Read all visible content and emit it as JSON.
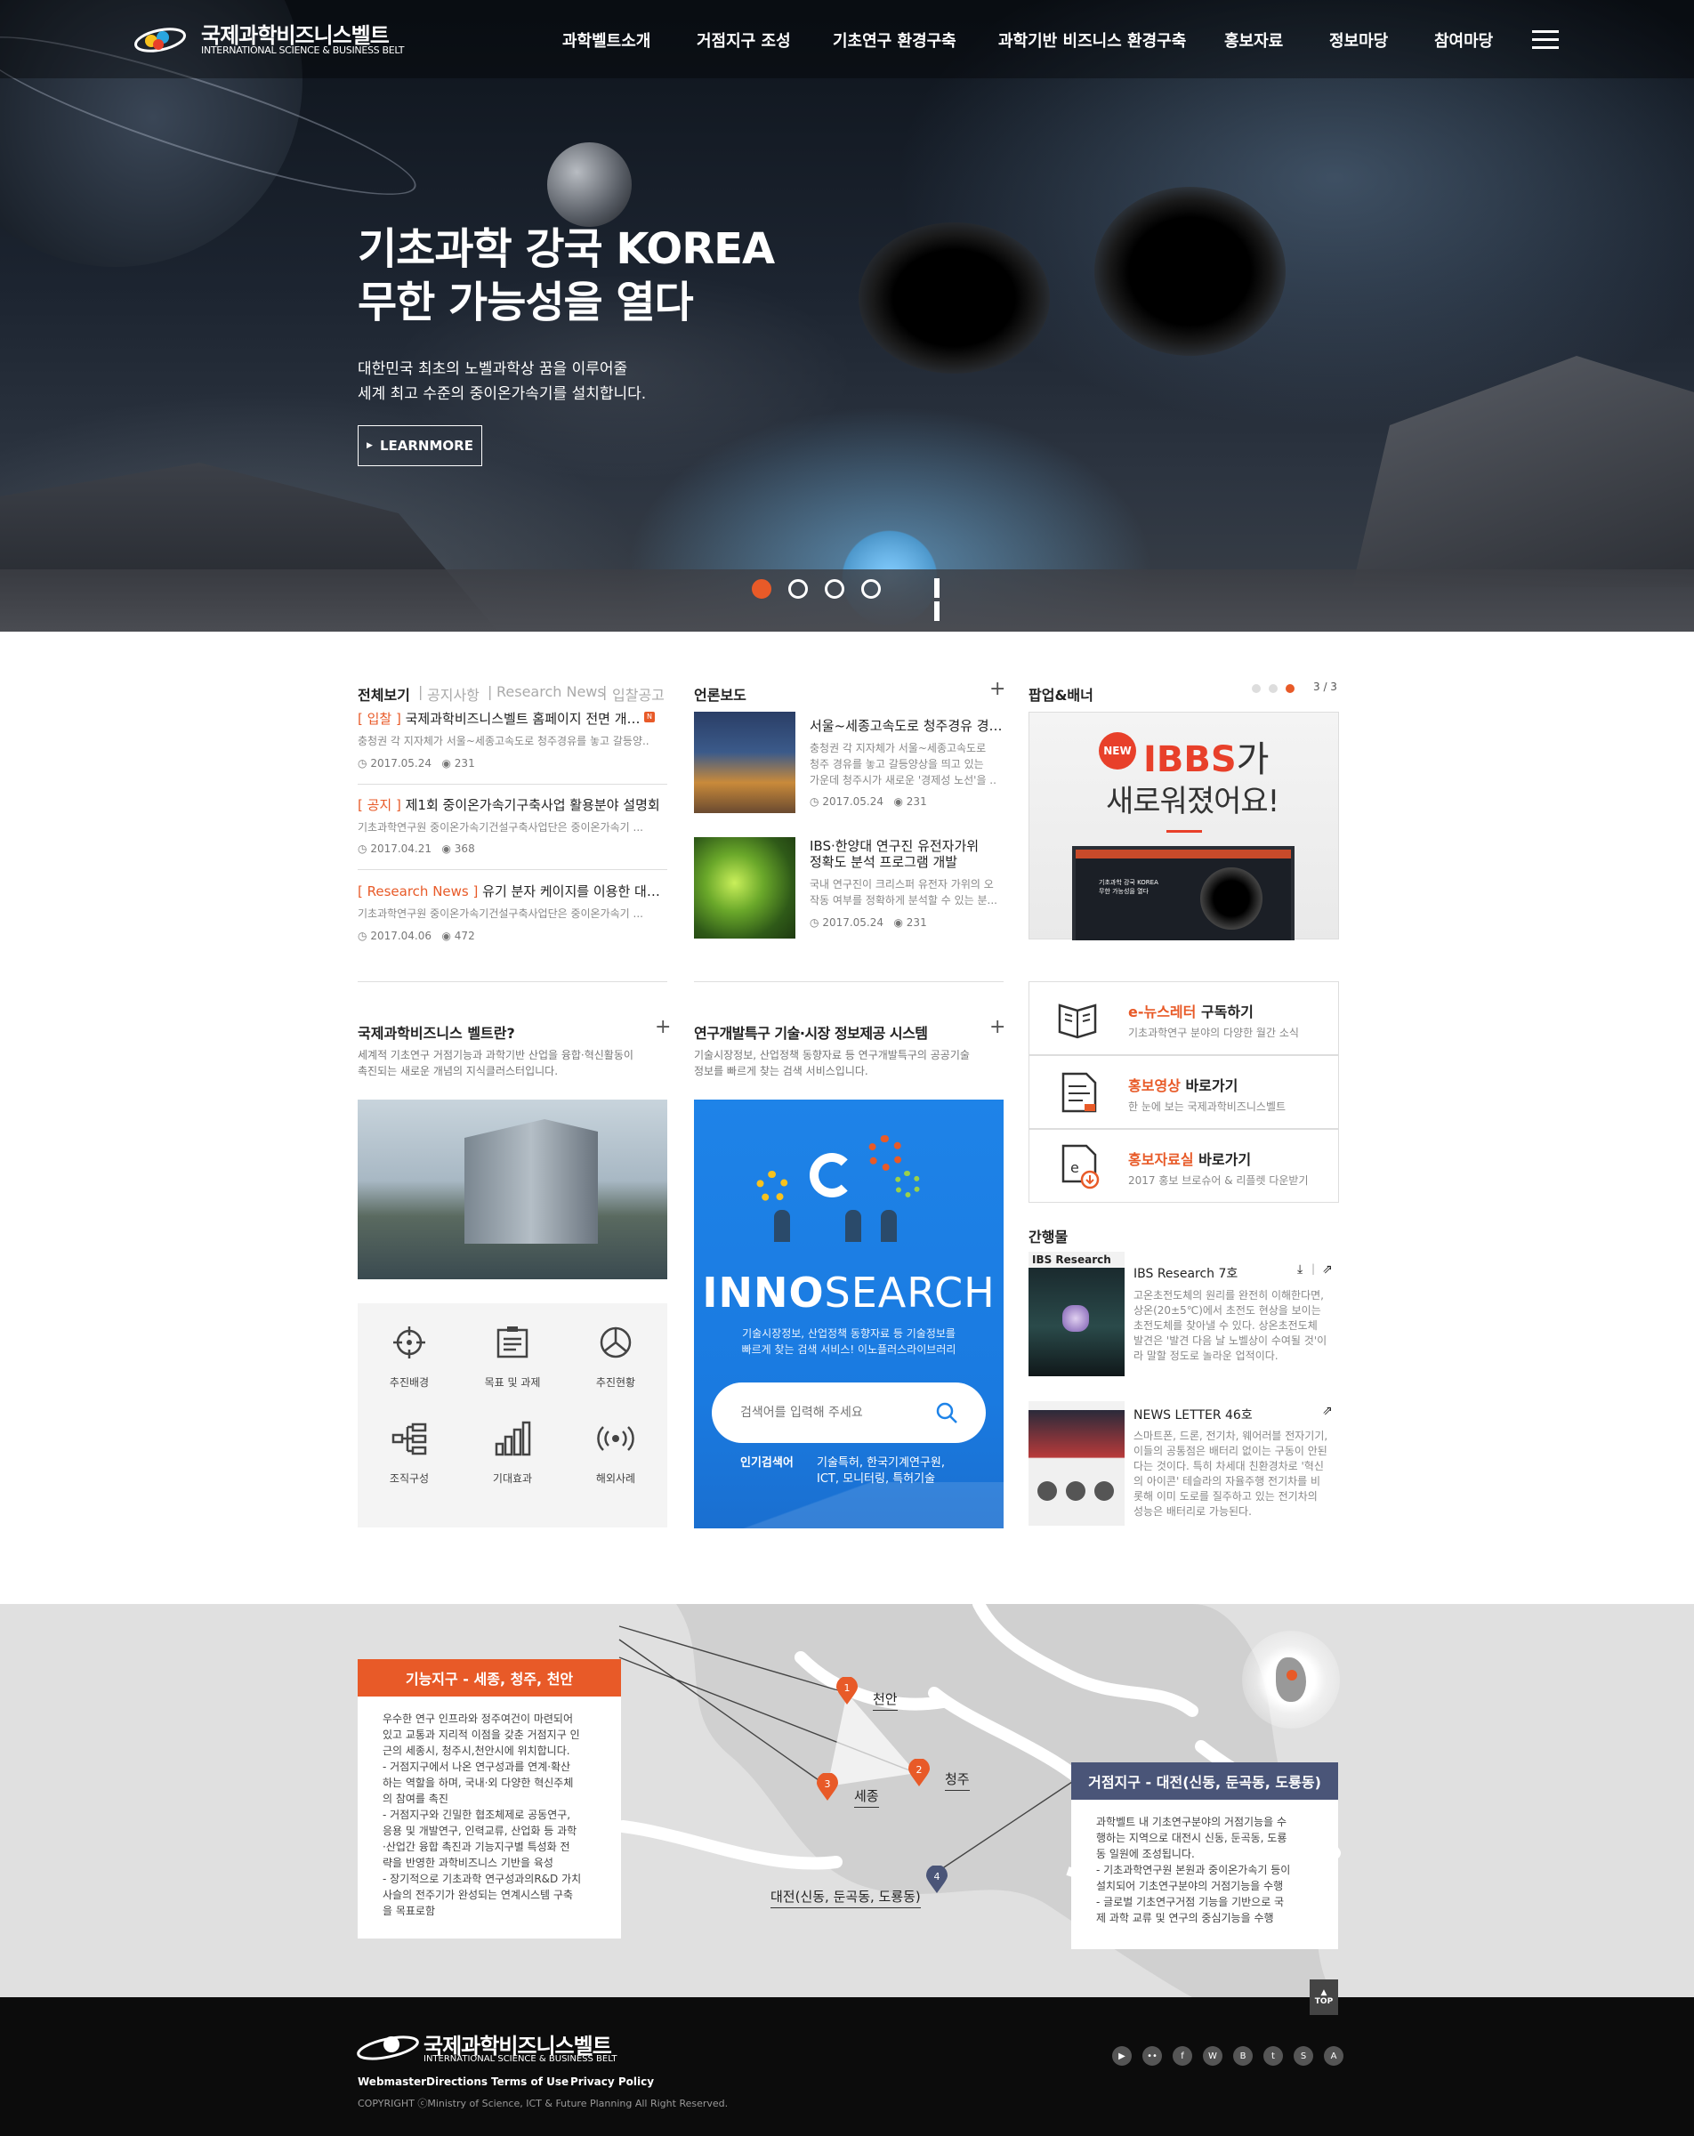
{
  "header": {
    "logo_ko": "국제과학비즈니스벨트",
    "logo_en": "INTERNATIONAL SCIENCE & BUSINESS BELT",
    "menu": [
      "과학벨트소개",
      "거점지구 조성",
      "기초연구 환경구축",
      "과학기반 비즈니스 환경구축",
      "홍보자료",
      "정보마당",
      "참여마당"
    ],
    "menu_icon": "hamburger-icon"
  },
  "hero": {
    "title1": "기초과학 강국 KOREA",
    "title2": "무한 가능성을 열다",
    "sub1": "대한민국 최초의 노벨과학상 꿈을 이루어줄",
    "sub2": "세계 최고 수준의 중이온가속기를 설치합니다.",
    "button": "LEARNMORE",
    "slides": 4,
    "active_slide": 1
  },
  "notice": {
    "tabs": [
      "전체보기",
      "공지사항",
      "Research News",
      "입찰공고"
    ],
    "items": [
      {
        "tag": "[ 입찰 ]",
        "title": "국제과학비즈니스벨트 홈페이지 전면 개편 ..",
        "desc": "충청권 각 지자체가 서울~세종고속도로 청주경유를 놓고 갈등양..",
        "date": "2017.05.24",
        "views": "231",
        "new": "N"
      },
      {
        "tag": "[ 공지 ]",
        "title": "제1회 중이온가속기구축사업 활용분야 설명회",
        "desc": "기초과학연구원 중이온가속기건설구축사업단은 중이온가속기 ...",
        "date": "2017.04.21",
        "views": "368"
      },
      {
        "tag": "[ Research News ]",
        "title": "유기 분자 케이지를 이용한 대사성 ..",
        "desc": "기초과학연구원 중이온가속기건설구축사업단은 중이온가속기 ...",
        "date": "2017.04.06",
        "views": "472"
      }
    ]
  },
  "press": {
    "title": "언론보도",
    "items": [
      {
        "title": "서울~세종고속도로 청주경유 경제 ..",
        "desc": [
          "충청권 각 지자체가 서울~세종고속도로",
          "청주 경유를 놓고 갈등양상을 띄고 있는",
          "가운데 청주시가 새로운 '경제성 노선'을 .."
        ],
        "date": "2017.05.24",
        "views": "231"
      },
      {
        "title": "IBS·한양대 연구진 유전자가위",
        "title2": "정확도 분석 프로그램 개발",
        "desc": [
          "국내 연구진이 크리스퍼 유전자 가위의 오",
          "작동 여부를 정확하게 분석할 수 있는 분..."
        ],
        "date": "2017.05.24",
        "views": "231"
      }
    ]
  },
  "popup": {
    "title": "팝업&배너",
    "pager": "3 / 3",
    "new_badge": "NEW",
    "line1_a": "IBBS",
    "line1_b": "가",
    "line2": "새로워졌어요!",
    "mini_title": "기초과학 강국 KOREA",
    "mini_sub": "무한 가능성을 열다"
  },
  "belt": {
    "title": "국제과학비즈니스 벨트란?",
    "desc1": "세계적 기초연구 거점기능과 과학기반 산업을 융합·혁신활동이",
    "desc2": "촉진되는 새로운 개념의 지식클러스터입니다.",
    "grid": [
      {
        "label": "추진배경",
        "icon": "target-icon"
      },
      {
        "label": "목표 및 과제",
        "icon": "clipboard-icon"
      },
      {
        "label": "추진현황",
        "icon": "chart-circle-icon"
      },
      {
        "label": "조직구성",
        "icon": "org-chart-icon"
      },
      {
        "label": "기대효과",
        "icon": "bar-chart-icon"
      },
      {
        "label": "해외사례",
        "icon": "broadcast-icon"
      }
    ]
  },
  "rnd": {
    "title": "연구개발특구 기술·시장 정보제공 시스템",
    "desc1": "기술시장정보, 산업정책 동향자료 등 연구개발특구의 공공기술",
    "desc2": "정보를 빠르게 찾는 검색 서비스입니다.",
    "brand_a": "INNO",
    "brand_b": "SEARCH",
    "sub1": "기술시장정보, 산업정책 동향자료 등 기술정보를",
    "sub2": "빠르게 찾는 검색 서비스! 이노플러스라이브러리",
    "placeholder": "검색어를 입력해 주세요",
    "popular_label": "인기검색어",
    "popular1": "기술특허, 한국기계연구원,",
    "popular2": "ICT, 모니터링, 특허기술"
  },
  "quick": [
    {
      "hl": "e-뉴스레터",
      "rest": " 구독하기",
      "desc": "기초과학연구 분야의 다양한 월간 소식",
      "icon": "book-icon"
    },
    {
      "hl": "홍보영상",
      "rest": " 바로가기",
      "desc": "한 눈에 보는 국제과학비즈니스벨트",
      "icon": "document-icon"
    },
    {
      "hl": "홍보자료실",
      "rest": " 바로가기",
      "desc": "2017 홍보 브로슈어 & 리플렛 다운받기",
      "icon": "download-doc-icon"
    }
  ],
  "pubs": {
    "title": "간행물",
    "items": [
      {
        "name": "IBS Research 7호",
        "cover": "IBS Research",
        "desc": [
          "고온초전도체의 원리를 완전히 이해한다면,",
          "상온(20±5℃)에서 초전도 현상을 보이는",
          "초전도체를 찾아낼 수 있다. 상온초전도체",
          "발견은 '발견 다음 날 노벨상이 수여될 것'이",
          "라 말할 정도로 놀라운 업적이다."
        ]
      },
      {
        "name": "NEWS LETTER 46호",
        "desc": [
          "스마트폰, 드론, 전기차, 웨어러블 전자기기,",
          "이들의 공통점은 배터리 없이는 구동이 안된",
          "다는 것이다. 특히 차세대 친환경차로 '혁신",
          "의 아이콘' 테슬라의 자율주행 전기차를 비",
          "롯해 이미 도로를 질주하고 있는 전기차의",
          "성능은 배터리로 가능된다."
        ]
      }
    ]
  },
  "map": {
    "left_title": "기능지구 - 세종, 청주, 천안",
    "left_body": [
      "우수한 연구 인프라와 정주여건이 마련되어",
      "있고 교통과 지리적 이점을 갖춘 거점지구 인",
      "근의 세종시, 청주시,천안시에 위치합니다.",
      "- 거점지구에서 나온 연구성과를 연계·확산",
      "  하는 역할을 하며, 국내·외 다양한 혁신주체",
      "  의 참여를 촉진",
      "- 거점지구와 긴밀한 협조체제로 공동연구,",
      "  응용 및 개발연구, 인력교류, 산업화 등 과학",
      "  ·산업간 융합 촉진과 기능지구별 특성화 전",
      "  략을 반영한 과학비즈니스 기반을 육성",
      "- 장기적으로 기초과학 연구성과의R&D 가치",
      "  사슬의 전주기가 완성되는 연계시스템 구축",
      "  을 목표로함"
    ],
    "right_title": "거점지구 - 대전(신동, 둔곡동, 도룡동)",
    "right_body": [
      "과학벨트 내 기초연구분야의 거점기능을 수",
      "행하는 지역으로 대전시 신동, 둔곡동, 도룡",
      "동 일원에 조성됩니다.",
      "- 기초과학연구원 본원과 중이온가속기 등이",
      "  설치되어 기초연구분야의 거점기능을 수행",
      "- 글로벌 기초연구거점 기능을 기반으로 국",
      "  제 과학 교류 및 연구의 중심기능을 수행"
    ],
    "pins": [
      {
        "num": "1",
        "label": "천안",
        "color": "#e85a28"
      },
      {
        "num": "2",
        "label": "청주",
        "color": "#e85a28"
      },
      {
        "num": "3",
        "label": "세종",
        "color": "#e85a28"
      },
      {
        "num": "4",
        "label": "대전(신동, 둔곡동, 도룡동)",
        "color": "#4a5578"
      }
    ]
  },
  "footer": {
    "logo_ko": "국제과학비즈니스벨트",
    "logo_en": "INTERNATIONAL SCIENCE & BUSINESS BELT",
    "links": [
      "Webmaster",
      "Directions",
      "Terms of Use",
      "Privacy Policy"
    ],
    "copyright": "COPYRIGHT ⓒMinistry of Science, ICT & Future Planning All Right Reserved.",
    "top": "TOP",
    "sns": [
      "youtube-icon",
      "flickr-icon",
      "facebook-icon",
      "weibo-icon",
      "blog-icon",
      "twitter-icon",
      "story-icon",
      "app-icon"
    ]
  },
  "colors": {
    "accent": "#e85a28",
    "navy": "#4a5578",
    "blue": "#1e83e8"
  }
}
